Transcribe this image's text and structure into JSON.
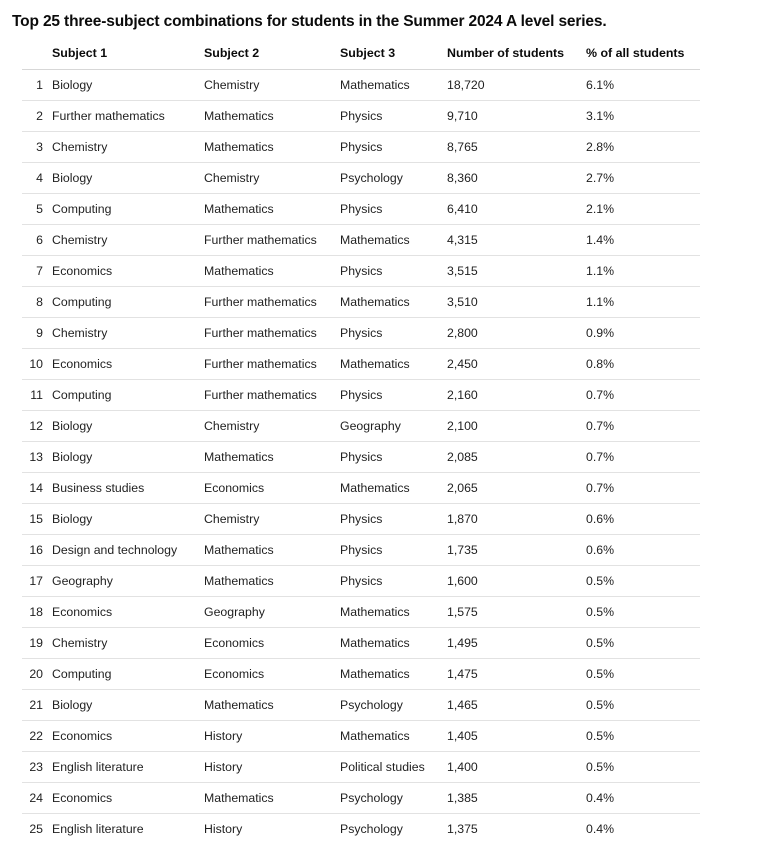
{
  "title": "Top 25 three-subject combinations for students in the Summer 2024 A level series.",
  "table": {
    "columns": [
      {
        "key": "rank",
        "label": ""
      },
      {
        "key": "subject1",
        "label": "Subject 1"
      },
      {
        "key": "subject2",
        "label": "Subject 2"
      },
      {
        "key": "subject3",
        "label": "Subject 3"
      },
      {
        "key": "number",
        "label": "Number of students"
      },
      {
        "key": "percent",
        "label": "% of all students"
      }
    ],
    "rows": [
      {
        "rank": "1",
        "subject1": "Biology",
        "subject2": "Chemistry",
        "subject3": "Mathematics",
        "number": "18,720",
        "percent": "6.1%"
      },
      {
        "rank": "2",
        "subject1": "Further mathematics",
        "subject2": "Mathematics",
        "subject3": "Physics",
        "number": "9,710",
        "percent": "3.1%"
      },
      {
        "rank": "3",
        "subject1": "Chemistry",
        "subject2": "Mathematics",
        "subject3": "Physics",
        "number": "8,765",
        "percent": "2.8%"
      },
      {
        "rank": "4",
        "subject1": "Biology",
        "subject2": "Chemistry",
        "subject3": "Psychology",
        "number": "8,360",
        "percent": "2.7%"
      },
      {
        "rank": "5",
        "subject1": "Computing",
        "subject2": "Mathematics",
        "subject3": "Physics",
        "number": "6,410",
        "percent": "2.1%"
      },
      {
        "rank": "6",
        "subject1": "Chemistry",
        "subject2": "Further mathematics",
        "subject3": "Mathematics",
        "number": "4,315",
        "percent": "1.4%"
      },
      {
        "rank": "7",
        "subject1": "Economics",
        "subject2": "Mathematics",
        "subject3": "Physics",
        "number": "3,515",
        "percent": "1.1%"
      },
      {
        "rank": "8",
        "subject1": "Computing",
        "subject2": "Further mathematics",
        "subject3": "Mathematics",
        "number": "3,510",
        "percent": "1.1%"
      },
      {
        "rank": "9",
        "subject1": "Chemistry",
        "subject2": "Further mathematics",
        "subject3": "Physics",
        "number": "2,800",
        "percent": "0.9%"
      },
      {
        "rank": "10",
        "subject1": "Economics",
        "subject2": "Further mathematics",
        "subject3": "Mathematics",
        "number": "2,450",
        "percent": "0.8%"
      },
      {
        "rank": "11",
        "subject1": "Computing",
        "subject2": "Further mathematics",
        "subject3": "Physics",
        "number": "2,160",
        "percent": "0.7%"
      },
      {
        "rank": "12",
        "subject1": "Biology",
        "subject2": "Chemistry",
        "subject3": "Geography",
        "number": "2,100",
        "percent": "0.7%"
      },
      {
        "rank": "13",
        "subject1": "Biology",
        "subject2": "Mathematics",
        "subject3": "Physics",
        "number": "2,085",
        "percent": "0.7%"
      },
      {
        "rank": "14",
        "subject1": "Business studies",
        "subject2": "Economics",
        "subject3": "Mathematics",
        "number": "2,065",
        "percent": "0.7%"
      },
      {
        "rank": "15",
        "subject1": "Biology",
        "subject2": "Chemistry",
        "subject3": "Physics",
        "number": "1,870",
        "percent": "0.6%"
      },
      {
        "rank": "16",
        "subject1": "Design and technology",
        "subject2": "Mathematics",
        "subject3": "Physics",
        "number": "1,735",
        "percent": "0.6%"
      },
      {
        "rank": "17",
        "subject1": "Geography",
        "subject2": "Mathematics",
        "subject3": "Physics",
        "number": "1,600",
        "percent": "0.5%"
      },
      {
        "rank": "18",
        "subject1": "Economics",
        "subject2": "Geography",
        "subject3": "Mathematics",
        "number": "1,575",
        "percent": "0.5%"
      },
      {
        "rank": "19",
        "subject1": "Chemistry",
        "subject2": "Economics",
        "subject3": "Mathematics",
        "number": "1,495",
        "percent": "0.5%"
      },
      {
        "rank": "20",
        "subject1": "Computing",
        "subject2": "Economics",
        "subject3": "Mathematics",
        "number": "1,475",
        "percent": "0.5%"
      },
      {
        "rank": "21",
        "subject1": "Biology",
        "subject2": "Mathematics",
        "subject3": "Psychology",
        "number": "1,465",
        "percent": "0.5%"
      },
      {
        "rank": "22",
        "subject1": "Economics",
        "subject2": "History",
        "subject3": "Mathematics",
        "number": "1,405",
        "percent": "0.5%"
      },
      {
        "rank": "23",
        "subject1": "English literature",
        "subject2": "History",
        "subject3": "Political studies",
        "number": "1,400",
        "percent": "0.5%"
      },
      {
        "rank": "24",
        "subject1": "Economics",
        "subject2": "Mathematics",
        "subject3": "Psychology",
        "number": "1,385",
        "percent": "0.4%"
      },
      {
        "rank": "25",
        "subject1": "English literature",
        "subject2": "History",
        "subject3": "Psychology",
        "number": "1,375",
        "percent": "0.4%"
      }
    ]
  },
  "chart_data": {
    "type": "table",
    "title": "Top 25 three-subject combinations for students in the Summer 2024 A level series.",
    "columns": [
      "Subject 1",
      "Subject 2",
      "Subject 3",
      "Number of students",
      "% of all students"
    ],
    "categories": [
      "Biology / Chemistry / Mathematics",
      "Further mathematics / Mathematics / Physics",
      "Chemistry / Mathematics / Physics",
      "Biology / Chemistry / Psychology",
      "Computing / Mathematics / Physics",
      "Chemistry / Further mathematics / Mathematics",
      "Economics / Mathematics / Physics",
      "Computing / Further mathematics / Mathematics",
      "Chemistry / Further mathematics / Physics",
      "Economics / Further mathematics / Mathematics",
      "Computing / Further mathematics / Physics",
      "Biology / Chemistry / Geography",
      "Biology / Mathematics / Physics",
      "Business studies / Economics / Mathematics",
      "Biology / Chemistry / Physics",
      "Design and technology / Mathematics / Physics",
      "Geography / Mathematics / Physics",
      "Economics / Geography / Mathematics",
      "Chemistry / Economics / Mathematics",
      "Computing / Economics / Mathematics",
      "Biology / Mathematics / Psychology",
      "Economics / History / Mathematics",
      "English literature / History / Political studies",
      "Economics / Mathematics / Psychology",
      "English literature / History / Psychology"
    ],
    "series": [
      {
        "name": "Number of students",
        "values": [
          18720,
          9710,
          8765,
          8360,
          6410,
          4315,
          3515,
          3510,
          2800,
          2450,
          2160,
          2100,
          2085,
          2065,
          1870,
          1735,
          1600,
          1575,
          1495,
          1475,
          1465,
          1405,
          1400,
          1385,
          1375
        ]
      },
      {
        "name": "% of all students",
        "values": [
          6.1,
          3.1,
          2.8,
          2.7,
          2.1,
          1.4,
          1.1,
          1.1,
          0.9,
          0.8,
          0.7,
          0.7,
          0.7,
          0.7,
          0.6,
          0.6,
          0.5,
          0.5,
          0.5,
          0.5,
          0.5,
          0.5,
          0.5,
          0.4,
          0.4
        ]
      }
    ],
    "xlabel": "",
    "ylabel": "",
    "grid": false,
    "legend": "none"
  }
}
